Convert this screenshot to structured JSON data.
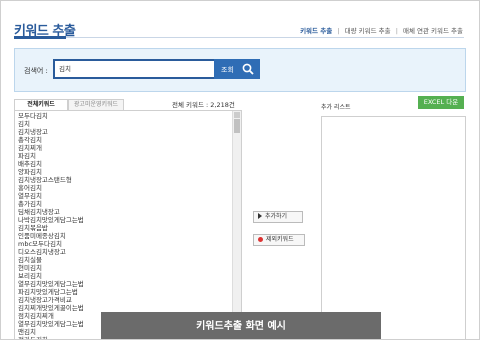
{
  "header": {
    "title": "키워드 추출",
    "breadcrumbs": [
      "키워드 추출",
      "대량 키워드 추출",
      "매체 연관 키워드 추출"
    ]
  },
  "search": {
    "label": "검색어 :",
    "value": "김치",
    "button_label": "조회"
  },
  "tabs": [
    {
      "label": "전체키워드",
      "active": true
    },
    {
      "label": "광고미운영키워드",
      "active": false
    }
  ],
  "total_count": "전체 키워드 : 2,218건",
  "keywords": [
    "모두다김치",
    "김치",
    "김치냉장고",
    "총각김치",
    "김치찌개",
    "파김치",
    "배추김치",
    "양파김치",
    "김치냉장고스탠드형",
    "홍어김치",
    "열무김치",
    "총가김치",
    "딤채김치냉장고",
    "나박김치맛있게담그는법",
    "김치볶음밥",
    "인품미메종상김치",
    "mbc모두다김치",
    "디오스김치냉장고",
    "김치실물",
    "현미김치",
    "보리김치",
    "열무김치맛있게담그는법",
    "파김치맛있게담그는법",
    "김치냉장고가격비교",
    "김치찌개맛있게끓이는법",
    "점치김치찌개",
    "열무김치맛있게담그는법",
    "맨김치",
    "전라도김치",
    "오모다김치맛찌"
  ],
  "buttons": {
    "add": "추가하기",
    "remove": "제외키워드",
    "excel": "EXCEL 다운"
  },
  "add_list_label": "추가 리스트",
  "caption": "키워드추출 화면 예시",
  "colors": {
    "brand": "#2a5b9b",
    "search_bg": "#e9f3fb",
    "excel": "#55b051",
    "caption_bg": "#6b6b6b"
  }
}
